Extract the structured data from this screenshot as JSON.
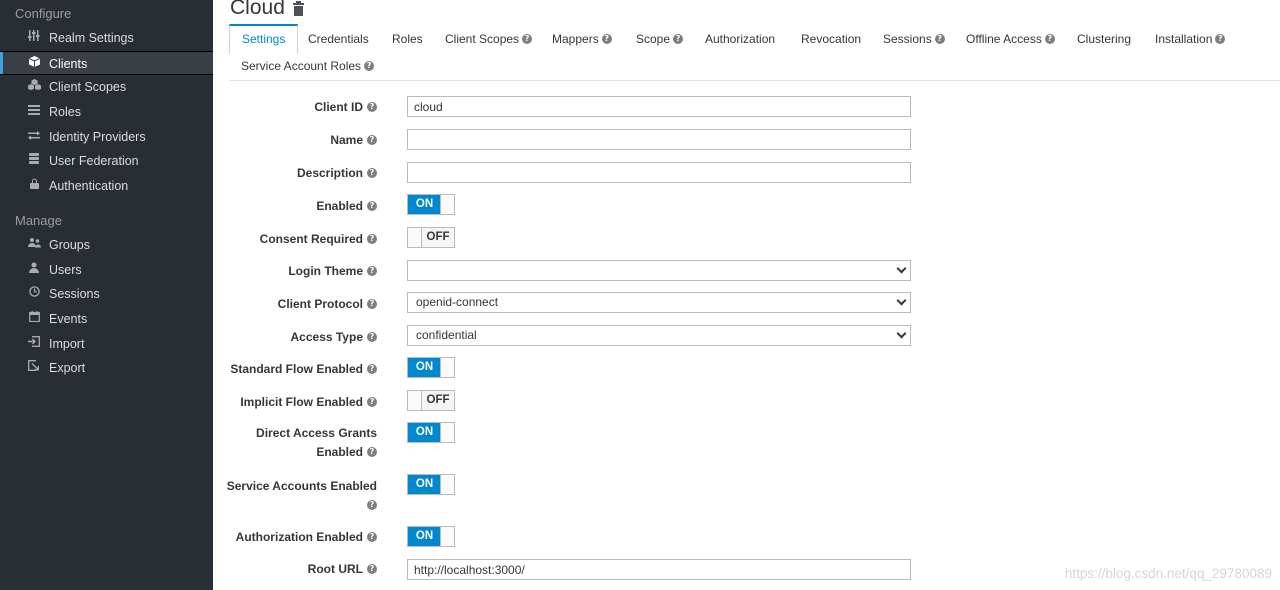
{
  "sidebar": {
    "configure_title": "Configure",
    "configure_items": [
      {
        "label": "Realm Settings",
        "icon": "sliders-icon"
      },
      {
        "label": "Clients",
        "icon": "cube-icon",
        "active": true
      },
      {
        "label": "Client Scopes",
        "icon": "cubes-icon"
      },
      {
        "label": "Roles",
        "icon": "list-icon"
      },
      {
        "label": "Identity Providers",
        "icon": "exchange-icon"
      },
      {
        "label": "User Federation",
        "icon": "database-icon"
      },
      {
        "label": "Authentication",
        "icon": "lock-icon"
      }
    ],
    "manage_title": "Manage",
    "manage_items": [
      {
        "label": "Groups",
        "icon": "users-icon"
      },
      {
        "label": "Users",
        "icon": "user-icon"
      },
      {
        "label": "Sessions",
        "icon": "clock-icon"
      },
      {
        "label": "Events",
        "icon": "calendar-icon"
      },
      {
        "label": "Import",
        "icon": "import-icon"
      },
      {
        "label": "Export",
        "icon": "export-icon"
      }
    ]
  },
  "header": {
    "title": "Cloud",
    "delete_icon": "trash-icon"
  },
  "tabs": [
    {
      "label": "Settings",
      "active": true
    },
    {
      "label": "Credentials"
    },
    {
      "label": "Roles"
    },
    {
      "label": "Client Scopes",
      "help": true
    },
    {
      "label": "Mappers",
      "help": true
    },
    {
      "label": "Scope",
      "help": true
    },
    {
      "label": "Authorization"
    },
    {
      "label": "Revocation"
    },
    {
      "label": "Sessions",
      "help": true
    },
    {
      "label": "Offline Access",
      "help": true
    },
    {
      "label": "Clustering"
    },
    {
      "label": "Installation",
      "help": true
    },
    {
      "label": "Service Account Roles",
      "help": true
    }
  ],
  "help_glyph": "?",
  "form": {
    "client_id": {
      "label": "Client ID",
      "value": "cloud"
    },
    "name": {
      "label": "Name",
      "value": ""
    },
    "description": {
      "label": "Description",
      "value": ""
    },
    "enabled": {
      "label": "Enabled",
      "state": "ON"
    },
    "consent_required": {
      "label": "Consent Required",
      "state": "OFF"
    },
    "login_theme": {
      "label": "Login Theme",
      "value": ""
    },
    "client_protocol": {
      "label": "Client Protocol",
      "value": "openid-connect"
    },
    "access_type": {
      "label": "Access Type",
      "value": "confidential"
    },
    "standard_flow": {
      "label": "Standard Flow Enabled",
      "state": "ON"
    },
    "implicit_flow": {
      "label": "Implicit Flow Enabled",
      "state": "OFF"
    },
    "direct_access": {
      "label_line1": "Direct Access Grants",
      "label_line2": "Enabled",
      "state": "ON"
    },
    "service_accounts": {
      "label": "Service Accounts Enabled",
      "state": "ON"
    },
    "authorization": {
      "label": "Authorization Enabled",
      "state": "ON"
    },
    "root_url": {
      "label": "Root URL",
      "value": "http://localhost:3000/"
    }
  },
  "watermark": "https://blog.csdn.net/qq_29780089",
  "colors": {
    "accent": "#0088ce",
    "sidebar_bg": "#292e34",
    "active_bar": "#39a5dc"
  }
}
